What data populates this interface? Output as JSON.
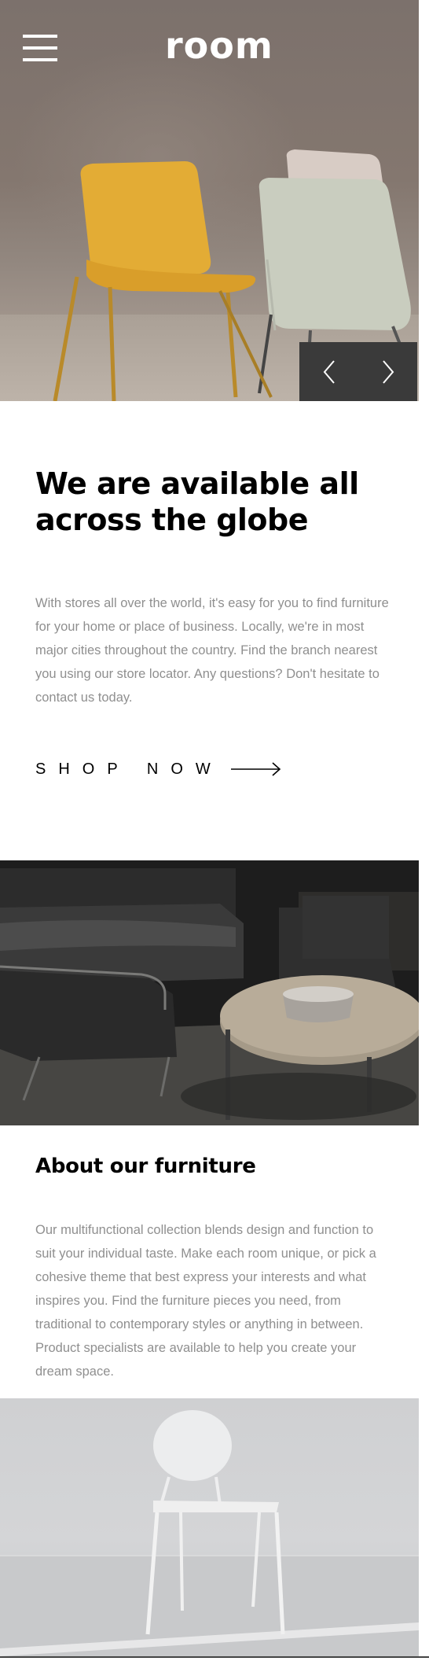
{
  "header": {
    "logo": "room",
    "menu_icon": "hamburger-menu-icon"
  },
  "hero": {
    "prev_icon": "chevron-left-icon",
    "next_icon": "chevron-right-icon"
  },
  "intro": {
    "title": "We are available all across the globe",
    "text": "With stores all over the world, it's easy for you to find furniture for your home or place of business. Locally, we're in most major cities throughout the country. Find the branch nearest you using our store locator. Any questions? Don't hesitate to contact us today.",
    "cta_label": "SHOP NOW",
    "cta_icon": "arrow-right-icon"
  },
  "about": {
    "title": "About our furniture",
    "text": "Our multifunctional collection blends design and function to suit your individual taste. Make each room unique, or pick a cohesive theme that best express your interests and what inspires you. Find the furniture pieces you need, from traditional to contemporary styles or anything in between. Product specialists are available to help you create your dream space."
  },
  "colors": {
    "text_primary": "#000000",
    "text_muted": "#8f8f8f",
    "slider_bg": "#3a3a3a",
    "chair_yellow": "#e3ac35"
  }
}
